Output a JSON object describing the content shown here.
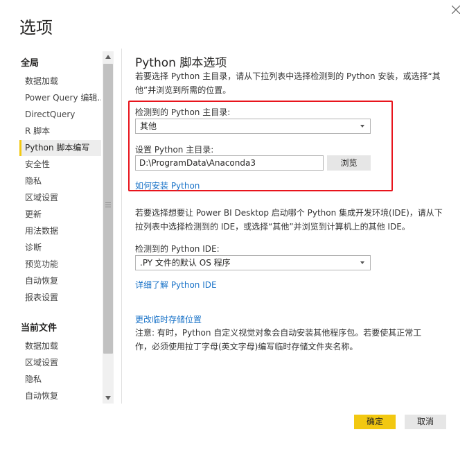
{
  "dialog": {
    "title": "选项"
  },
  "nav": {
    "global_title": "全局",
    "global_items": [
      {
        "label": "数据加载"
      },
      {
        "label": "Power Query 编辑..."
      },
      {
        "label": "DirectQuery"
      },
      {
        "label": "R 脚本"
      },
      {
        "label": "Python 脚本编写",
        "selected": true
      },
      {
        "label": "安全性"
      },
      {
        "label": "隐私"
      },
      {
        "label": "区域设置"
      },
      {
        "label": "更新"
      },
      {
        "label": "用法数据"
      },
      {
        "label": "诊断"
      },
      {
        "label": "预览功能"
      },
      {
        "label": "自动恢复"
      },
      {
        "label": "报表设置"
      }
    ],
    "current_title": "当前文件",
    "current_items": [
      {
        "label": "数据加载"
      },
      {
        "label": "区域设置"
      },
      {
        "label": "隐私"
      },
      {
        "label": "自动恢复"
      }
    ]
  },
  "main": {
    "title": "Python 脚本选项",
    "intro_line1": "若要选择 Python 主目录，请从下拉列表中选择检测到的 Python 安装，或选择“其",
    "intro_line2": "他”并浏览到所需的位置。",
    "detected_home_label": "检测到的 Python 主目录:",
    "detected_home_value": "其他",
    "set_home_label": "设置 Python 主目录:",
    "set_home_value": "D:\\ProgramData\\Anaconda3",
    "browse_label": "浏览",
    "install_link": "如何安装 Python",
    "ide_intro_line1": "若要选择想要让 Power BI Desktop 启动哪个 Python 集成开发环境(IDE)，请从下",
    "ide_intro_line2": "拉列表中选择检测到的 IDE，或选择“其他”并浏览到计算机上的其他 IDE。",
    "detected_ide_label": "检测到的 Python IDE:",
    "detected_ide_value": ".PY 文件的默认 OS 程序",
    "learn_more_link": "详细了解 Python IDE",
    "temp_storage_link": "更改临时存储位置",
    "note_line1": "注意: 有时，Python 自定义视觉对象会自动安装其他程序包。若要使其正常工",
    "note_line2": "作，必须使用拉丁字母(英文字母)编写临时存储文件夹名称。"
  },
  "footer": {
    "ok_label": "确定",
    "cancel_label": "取消"
  },
  "colors": {
    "accent_yellow": "#f2c811",
    "highlight_red": "#e8141c",
    "link_blue": "#1a73c8"
  }
}
